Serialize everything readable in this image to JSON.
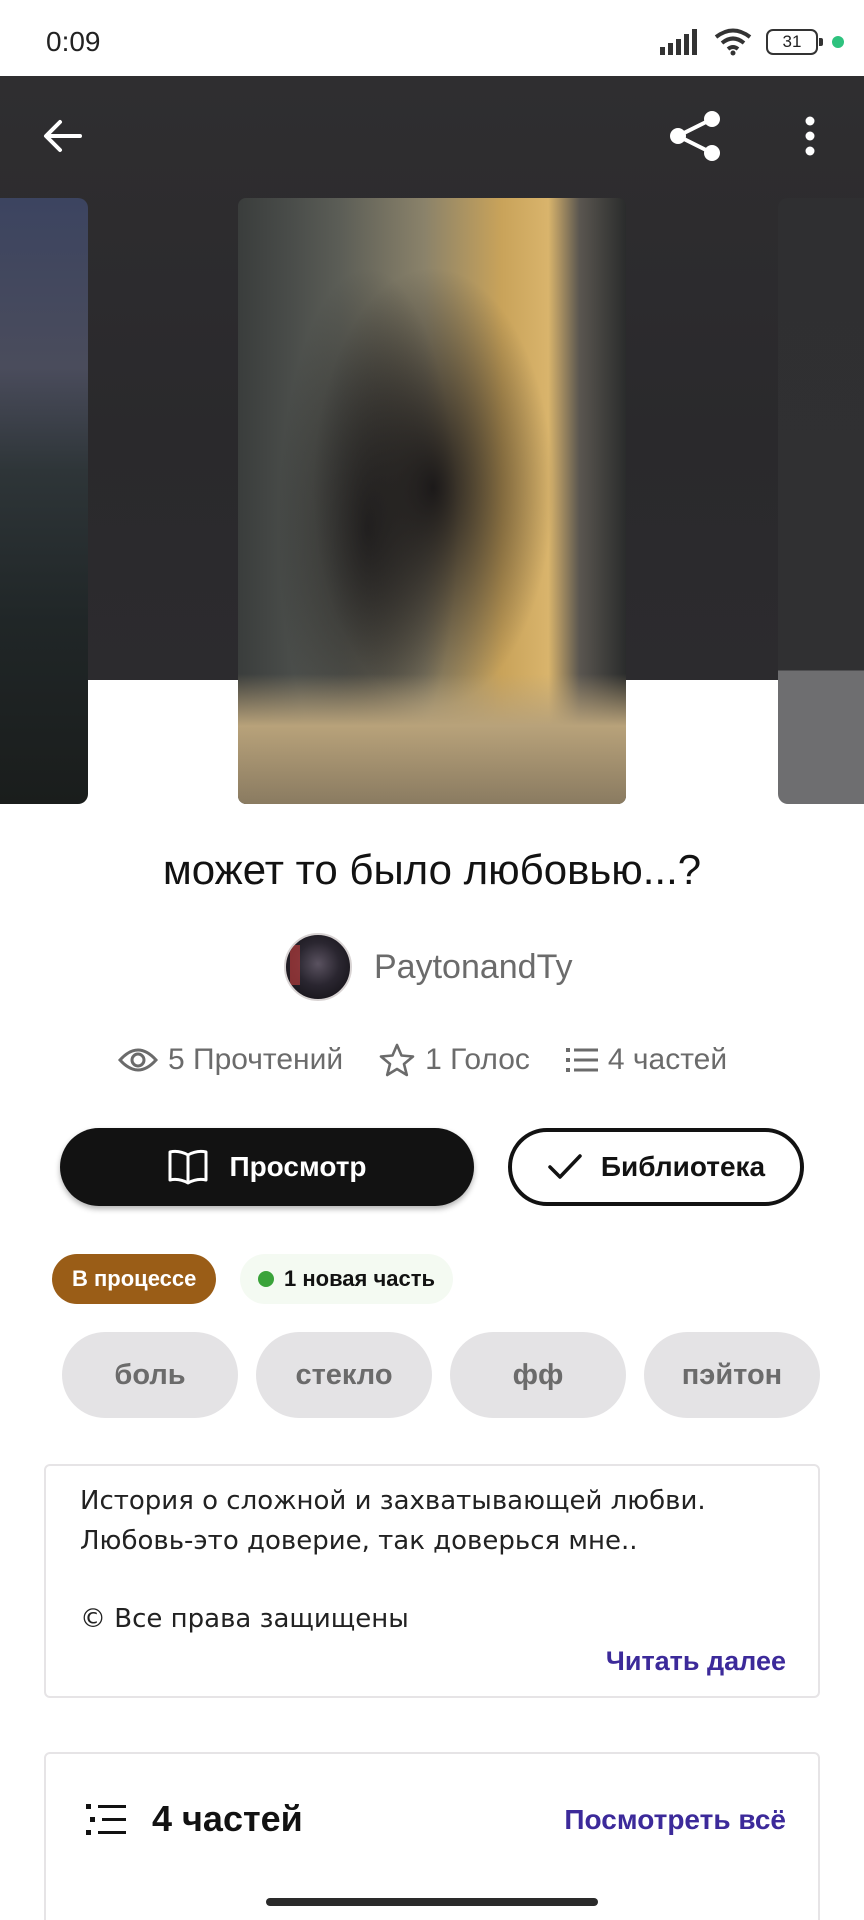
{
  "status_bar": {
    "time": "0:09",
    "battery": "31"
  },
  "story": {
    "title": "может то было любовью...?",
    "author": "PaytonandTy"
  },
  "stats": {
    "reads": "5 Прочтений",
    "votes": "1 Голос",
    "parts": "4 частей"
  },
  "actions": {
    "view_label": "Просмотр",
    "library_label": "Библиотека"
  },
  "badges": {
    "status": "В процессе",
    "new_part": "1 новая часть"
  },
  "tags": [
    "боль",
    "стекло",
    "фф",
    "пэйтон"
  ],
  "description": {
    "line1": "История о сложной и захватывающей любви.",
    "line2": "Любовь-это доверие, так доверься мне..",
    "copyright": "© Все права защищены",
    "read_more": "Читать далее"
  },
  "parts_section": {
    "title": "4 частей",
    "see_all": "Посмотреть всё"
  },
  "colors": {
    "accent": "#3c2a9a",
    "status_badge": "#9a5d17",
    "new_dot": "#3aa33a"
  },
  "icons": [
    "back-arrow-icon",
    "share-icon",
    "more-vert-icon",
    "eye-icon",
    "star-icon",
    "list-icon",
    "book-icon",
    "check-icon"
  ]
}
